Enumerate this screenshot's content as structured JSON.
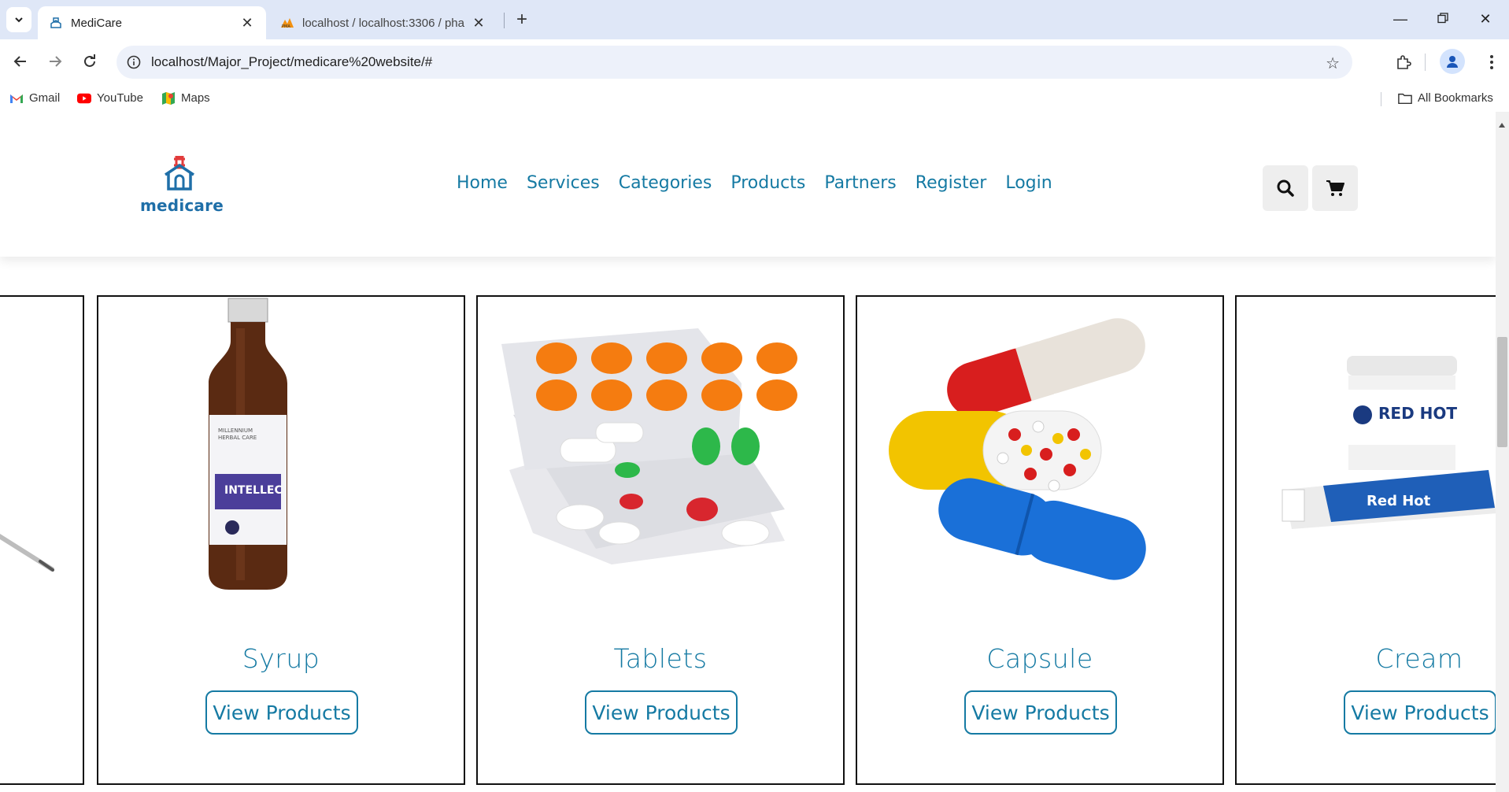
{
  "browser": {
    "tabs": [
      {
        "title": "MediCare",
        "active": true
      },
      {
        "title": "localhost / localhost:3306 / pha",
        "active": false
      }
    ],
    "url": "localhost/Major_Project/medicare%20website/#",
    "bookmarks": [
      {
        "label": "Gmail",
        "icon": "gmail-icon"
      },
      {
        "label": "YouTube",
        "icon": "youtube-icon"
      },
      {
        "label": "Maps",
        "icon": "maps-icon"
      }
    ],
    "all_bookmarks": "All Bookmarks"
  },
  "site": {
    "brand": "medicare",
    "nav": [
      "Home",
      "Services",
      "Categories",
      "Products",
      "Partners",
      "Register",
      "Login"
    ],
    "accent_color": "#157aa3"
  },
  "categories": [
    {
      "name": "Syrup",
      "button": "View Products"
    },
    {
      "name": "Tablets",
      "button": "View Products"
    },
    {
      "name": "Capsule",
      "button": "View Products"
    },
    {
      "name": "Cream",
      "button": "View Products"
    }
  ]
}
